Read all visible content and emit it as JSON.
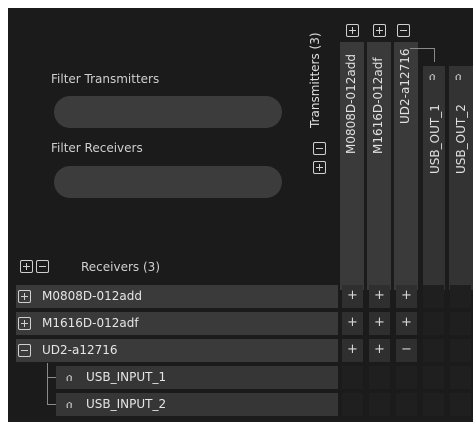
{
  "filters": {
    "transmitters_label": "Filter Transmitters",
    "receivers_label": "Filter Receivers",
    "transmitters_value": "",
    "receivers_value": ""
  },
  "transmitters_header": {
    "label": "Transmitters",
    "count": "(3)"
  },
  "receivers_header": {
    "label": "Receivers",
    "count": "(3)"
  },
  "transmitter_columns": [
    {
      "name": "M0808D-012add",
      "toggle": "expand"
    },
    {
      "name": "M1616D-012adf",
      "toggle": "expand"
    },
    {
      "name": "UD2-a12716",
      "toggle": "collapse"
    }
  ],
  "channel_columns": [
    {
      "name": "USB_OUT_1",
      "icon": "headphones-icon"
    },
    {
      "name": "USB_OUT_2",
      "icon": "headphones-icon"
    }
  ],
  "receiver_rows": [
    {
      "name": "M0808D-012add",
      "toggle": "expand",
      "cells": [
        "+",
        "+",
        "+",
        "",
        ""
      ]
    },
    {
      "name": "M1616D-012adf",
      "toggle": "expand",
      "cells": [
        "+",
        "+",
        "+",
        "",
        ""
      ]
    },
    {
      "name": "UD2-a12716",
      "toggle": "collapse",
      "cells": [
        "+",
        "+",
        "−",
        "",
        ""
      ]
    }
  ],
  "channel_rows": [
    {
      "name": "USB_INPUT_1",
      "icon": "headphones-icon"
    },
    {
      "name": "USB_INPUT_2",
      "icon": "headphones-icon"
    }
  ],
  "colors": {
    "background": "#1b1b1b",
    "row": "#3a3a3a",
    "input": "#3c3c3c"
  }
}
